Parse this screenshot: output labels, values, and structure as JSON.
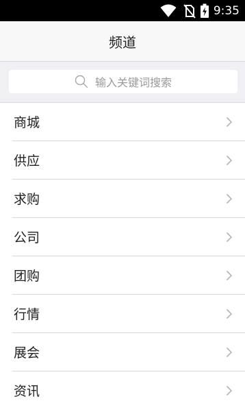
{
  "status_bar": {
    "time": "9:35"
  },
  "header": {
    "title": "频道"
  },
  "search": {
    "placeholder": "输入关键词搜索"
  },
  "channels": [
    {
      "label": "商城"
    },
    {
      "label": "供应"
    },
    {
      "label": "求购"
    },
    {
      "label": "公司"
    },
    {
      "label": "团购"
    },
    {
      "label": "行情"
    },
    {
      "label": "展会"
    },
    {
      "label": "资讯"
    }
  ],
  "colors": {
    "status_bar": "#000000",
    "nav_background": "#f8f8f8",
    "search_background": "#efeff4",
    "divider": "#d6d6d6",
    "chevron": "#b5b5b5"
  },
  "icons": [
    "wifi-icon",
    "no-sim-icon",
    "battery-charging-icon",
    "search-icon",
    "chevron-right-icon"
  ]
}
